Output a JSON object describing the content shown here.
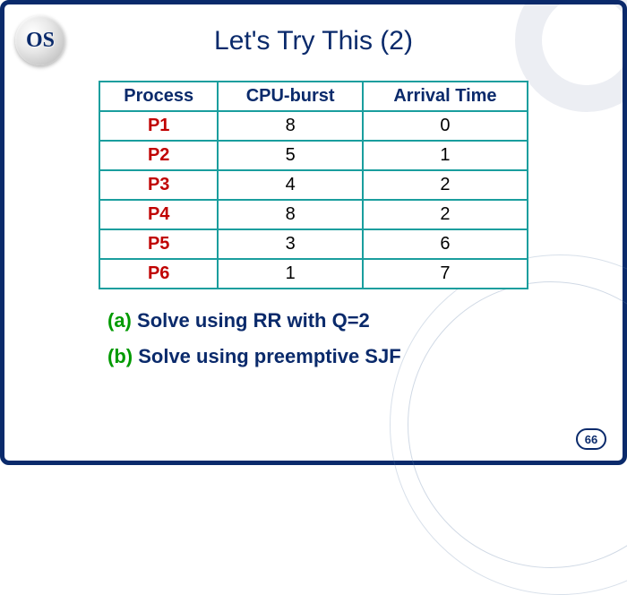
{
  "logo": "OS",
  "title": "Let's Try This (2)",
  "table": {
    "headers": [
      "Process",
      "CPU-burst",
      "Arrival Time"
    ],
    "rows": [
      {
        "process": "P1",
        "burst": "8",
        "arrival": "0"
      },
      {
        "process": "P2",
        "burst": "5",
        "arrival": "1"
      },
      {
        "process": "P3",
        "burst": "4",
        "arrival": "2"
      },
      {
        "process": "P4",
        "burst": "8",
        "arrival": "2"
      },
      {
        "process": "P5",
        "burst": "3",
        "arrival": "6"
      },
      {
        "process": "P6",
        "burst": "1",
        "arrival": "7"
      }
    ]
  },
  "prompts": [
    {
      "label": "(a)",
      "text": "Solve using RR with Q=2"
    },
    {
      "label": "(b)",
      "text": "Solve using preemptive SJF"
    }
  ],
  "page_number": "66",
  "chart_data": {
    "type": "table",
    "title": "Let's Try This (2)",
    "columns": [
      "Process",
      "CPU-burst",
      "Arrival Time"
    ],
    "rows": [
      [
        "P1",
        8,
        0
      ],
      [
        "P2",
        5,
        1
      ],
      [
        "P3",
        4,
        2
      ],
      [
        "P4",
        8,
        2
      ],
      [
        "P5",
        3,
        6
      ],
      [
        "P6",
        1,
        7
      ]
    ]
  }
}
